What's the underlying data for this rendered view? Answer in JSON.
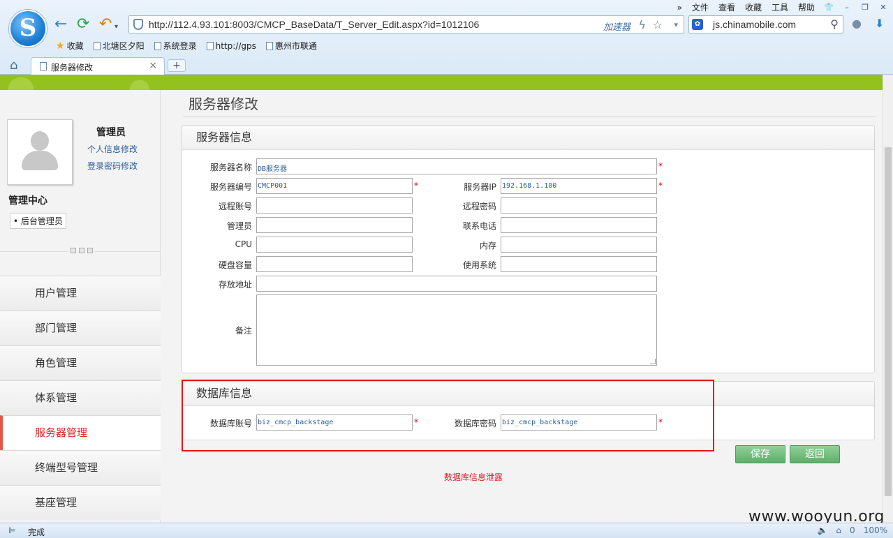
{
  "browser": {
    "logo_letter": "S",
    "top_menu": [
      "文件",
      "查看",
      "收藏",
      "工具",
      "帮助"
    ],
    "url": "http://112.4.93.101:8003/CMCP_BaseData/T_Server_Edit.aspx?id=1012106",
    "accelerator": "加速器",
    "search_text": "js.chinamobile.com",
    "bookmarks": [
      "收藏",
      "北塘区夕阳",
      "系统登录",
      "http://gps",
      "惠州市联通"
    ],
    "tab_title": "服务器修改",
    "status": "完成",
    "status_right": [
      "0",
      "100%"
    ]
  },
  "sidebar": {
    "username": "管理员",
    "link_profile": "个人信息修改",
    "link_password": "登录密码修改",
    "center_title": "管理中心",
    "role": "• 后台管理员",
    "menu": [
      "用户管理",
      "部门管理",
      "角色管理",
      "体系管理",
      "服务器管理",
      "终端型号管理",
      "基座管理"
    ],
    "active_index": 4
  },
  "content": {
    "page_title": "服务器修改",
    "server_panel": {
      "title": "服务器信息",
      "fields": {
        "name": {
          "label": "服务器名称",
          "value": "DB服务器"
        },
        "code": {
          "label": "服务器编号",
          "value": "CMCP001"
        },
        "ip": {
          "label": "服务器IP",
          "value": "192.168.1.100"
        },
        "remote_account": {
          "label": "远程账号",
          "value": ""
        },
        "remote_password": {
          "label": "远程密码",
          "value": ""
        },
        "admin": {
          "label": "管理员",
          "value": ""
        },
        "phone": {
          "label": "联系电话",
          "value": ""
        },
        "cpu": {
          "label": "CPU",
          "value": ""
        },
        "memory": {
          "label": "内存",
          "value": ""
        },
        "disk": {
          "label": "硬盘容量",
          "value": ""
        },
        "os": {
          "label": "使用系统",
          "value": ""
        },
        "location": {
          "label": "存放地址",
          "value": ""
        },
        "remark": {
          "label": "备注",
          "value": ""
        }
      },
      "required_mark": "*"
    },
    "db_panel": {
      "title": "数据库信息",
      "account": {
        "label": "数据库账号",
        "value": "biz_cmcp_backstage"
      },
      "password": {
        "label": "数据库密码",
        "value": "biz_cmcp_backstage"
      }
    },
    "save_label": "保存",
    "back_label": "返回",
    "leak_note": "数据库信息泄露",
    "watermark": "www.wooyun.org"
  },
  "colors": {
    "green_bar": "#93c11f",
    "active_menu": "#d32a2a",
    "highlight_box": "#e8141b",
    "button_green": "#5fae6a"
  }
}
